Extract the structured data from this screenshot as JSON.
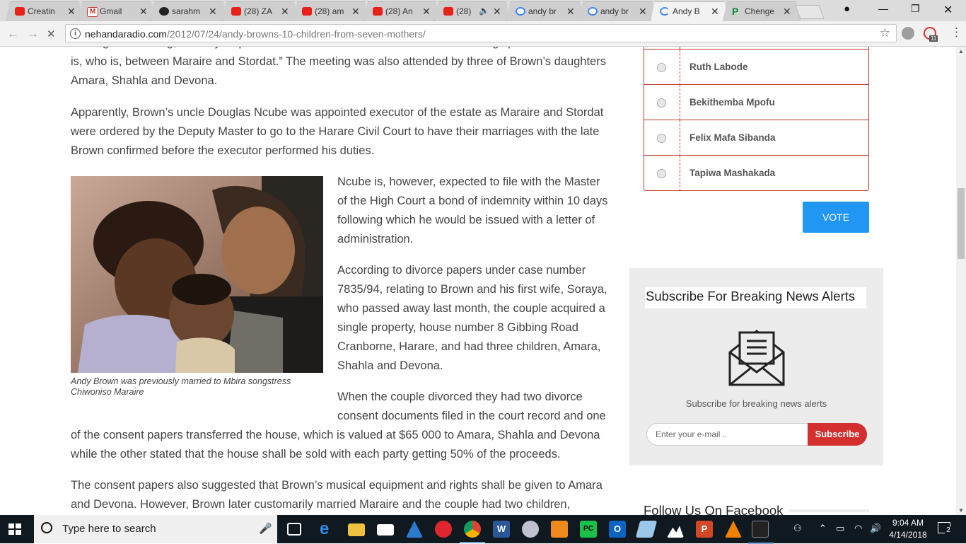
{
  "browser": {
    "tabs": [
      {
        "title": "Creatin",
        "favicon": "youtube-icon"
      },
      {
        "title": "Gmail",
        "favicon": "gmail-icon"
      },
      {
        "title": "sarahm",
        "favicon": "github-icon"
      },
      {
        "title": "(28) ZA",
        "favicon": "youtube-icon"
      },
      {
        "title": "(28) am",
        "favicon": "youtube-icon"
      },
      {
        "title": "(28) An",
        "favicon": "youtube-icon"
      },
      {
        "title": "(28)",
        "favicon": "youtube-icon"
      },
      {
        "title": "andy br",
        "favicon": "google-icon"
      },
      {
        "title": "andy br",
        "favicon": "google-icon"
      },
      {
        "title": "Andy B",
        "favicon": "loading-icon"
      },
      {
        "title": "Chenge",
        "favicon": "p-icon"
      }
    ],
    "active_tab_index": 9,
    "url_domain": "nehandaradio.com",
    "url_path": "/2012/07/24/andy-browns-10-children-from-seven-mothers/",
    "extension_badge": "11"
  },
  "article": {
    "para_clipped": "“During the meeting, the only dispute raised was whether or not there is a surviving spouse and if there is, who is, between Maraire and Stordat.” The meeting was also attended by three of Brown’s daughters Amara, Shahla and Devona.",
    "para_executor": "Apparently, Brown’s uncle Douglas Ncube was appointed executor of the estate as Maraire and Stordat were ordered by the Deputy Master to go to the Harare Civil Court to have their marriages with the late Brown confirmed before the executor performed his duties.",
    "para_bond": "Ncube is, however, expected to file with the Master of the High Court a bond of indemnity within 10 days following which he would be issued with a letter of administration.",
    "para_divorce": "According to divorce papers under case number 7835/94, relating to Brown and his first wife, Soraya, who passed away last month, the couple acquired a single property, house number 8 Gibbing Road Cranborne, Harare, and had three children, Amara, Shahla and Devona.",
    "para_consent_a": "When the couple divorced they had two divorce consent documents filed in the court record and one",
    "para_consent_b": "of the consent papers transferred the house, which is valued at $65 000 to Amara, Shahla and Devona while the other stated that the house shall be sold with each party getting 50% of the proceeds.",
    "para_equipment": "The consent papers also suggested that Brown’s musical equipment and rights shall be given to Amara and Devona. However, Brown later customarily married Maraire and the couple had two children,",
    "photo_caption": "Andy Brown was previously married to Mbira songstress Chiwoniso Maraire"
  },
  "poll": {
    "options": [
      "Ruth Labode",
      "Bekithemba Mpofu",
      "Felix Mafa Sibanda",
      "Tapiwa Mashakada"
    ],
    "vote_label": "VOTE"
  },
  "subscribe": {
    "title": "Subscribe For Breaking News Alerts",
    "description": "Subscribe for breaking news alerts",
    "email_placeholder": "Enter your e-mail ..",
    "button_label": "Subscribe"
  },
  "follow": {
    "title": "Follow Us On Facebook"
  },
  "taskbar": {
    "search_placeholder": "Type here to search",
    "time": "9:04 AM",
    "date": "4/14/2018",
    "notification_count": "2"
  },
  "colors": {
    "accent_blue": "#2196f3",
    "poll_border": "#c0392b",
    "subscribe_red": "#d32f2f",
    "taskbar_bg": "#101820"
  }
}
